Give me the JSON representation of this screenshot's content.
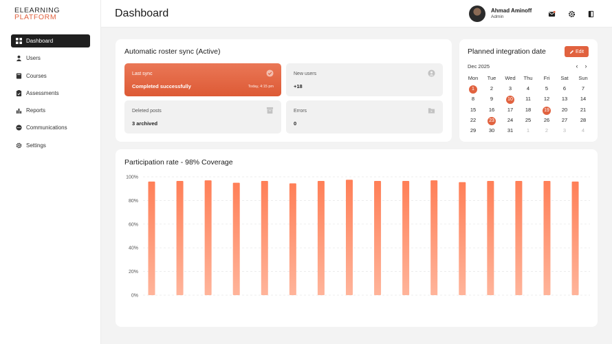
{
  "logo": {
    "line1": "ELEARNING",
    "line2": "PLATFORM"
  },
  "sidebar": {
    "items": [
      {
        "label": "Dashboard",
        "icon": "grid-icon",
        "active": true
      },
      {
        "label": "Users",
        "icon": "users-icon",
        "active": false
      },
      {
        "label": "Courses",
        "icon": "book-icon",
        "active": false
      },
      {
        "label": "Assessments",
        "icon": "clipboard-icon",
        "active": false
      },
      {
        "label": "Reports",
        "icon": "bar-chart-icon",
        "active": false
      },
      {
        "label": "Communications",
        "icon": "chat-icon",
        "active": false
      },
      {
        "label": "Settings",
        "icon": "gear-icon",
        "active": false
      }
    ]
  },
  "header": {
    "title": "Dashboard",
    "user": {
      "name": "Ahmad Aminoff",
      "role": "Admin"
    },
    "icons": [
      "mail-icon",
      "gear-icon",
      "panel-icon"
    ]
  },
  "sync": {
    "title": "Automatic roster sync (Active)",
    "tiles": [
      {
        "label": "Last sync",
        "value": "Completed successfully",
        "time": "Today, 4:15 pm",
        "icon": "check-circle-icon"
      },
      {
        "label": "New users",
        "value": "+18",
        "icon": "user-circle-icon"
      },
      {
        "label": "Deleted  posts",
        "value": "3 archived",
        "icon": "archive-icon"
      },
      {
        "label": "Errors",
        "value": "0",
        "icon": "folder-icon"
      }
    ]
  },
  "calendar": {
    "title": "Planned integration date",
    "edit_label": "Edit",
    "month": "Dec 2025",
    "weekdays": [
      "Mon",
      "Tue",
      "Wed",
      "Thu",
      "Fri",
      "Sat",
      "Sun"
    ],
    "weeks": [
      [
        "1",
        "2",
        "3",
        "4",
        "5",
        "6",
        "7"
      ],
      [
        "8",
        "9",
        "10",
        "11",
        "12",
        "13",
        "14"
      ],
      [
        "15",
        "16",
        "17",
        "18",
        "19",
        "20",
        "21"
      ],
      [
        "22",
        "23",
        "24",
        "25",
        "26",
        "27",
        "28"
      ],
      [
        "29",
        "30",
        "31",
        "1",
        "2",
        "3",
        "4"
      ]
    ],
    "marked": [
      "1",
      "10",
      "19",
      "23"
    ],
    "accent": "#e1623f"
  },
  "chart_data": {
    "type": "bar",
    "title": "Participation rate - 98% Coverage",
    "ylim": [
      0,
      100
    ],
    "yticks": [
      "0%",
      "20%",
      "40%",
      "60%",
      "80%",
      "100%"
    ],
    "grid": true,
    "color_top": "#ff7f57",
    "color_bottom": "#ffb49a",
    "values": [
      96,
      96.5,
      97,
      95,
      96.5,
      94.5,
      96.5,
      97.5,
      96.5,
      96.5,
      97,
      95.5,
      96.5,
      96.5,
      96.5,
      96
    ]
  }
}
